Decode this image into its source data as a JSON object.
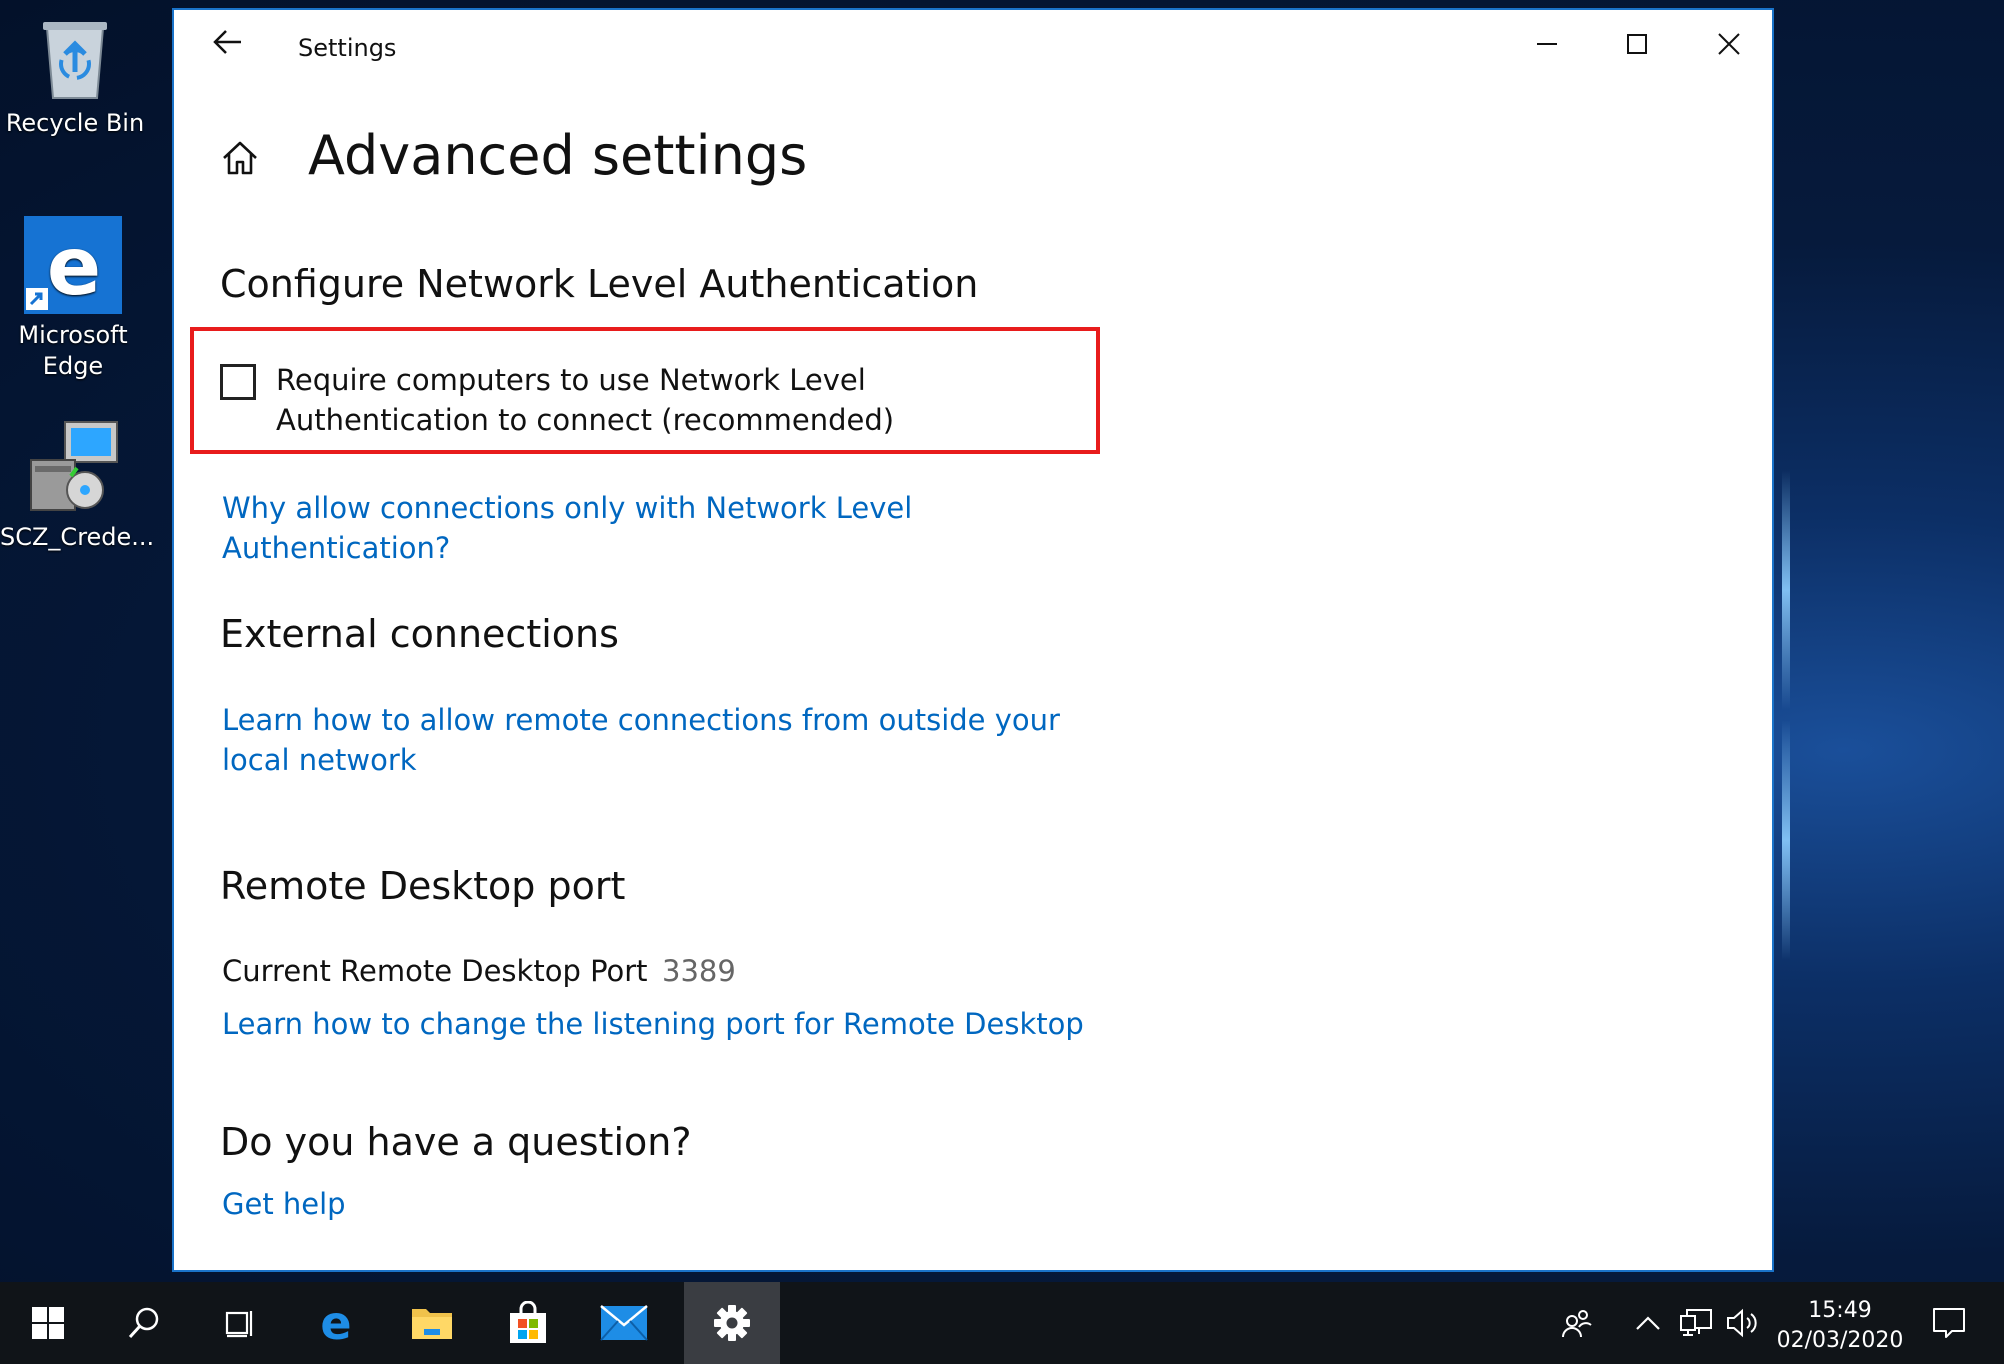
{
  "desktop": {
    "icons": [
      {
        "label": "Recycle Bin"
      },
      {
        "label": "Microsoft Edge"
      },
      {
        "label": "SCZ_Crede..."
      }
    ]
  },
  "window": {
    "title": "Settings",
    "page_title": "Advanced settings",
    "nla": {
      "heading": "Configure Network Level Authentication",
      "checkbox_label": "Require computers to use Network Level Authentication to connect (recommended)",
      "checkbox_checked": false,
      "link": "Why allow connections only with Network Level Authentication?"
    },
    "external": {
      "heading": "External connections",
      "link": "Learn how to allow remote connections from outside your local network"
    },
    "port": {
      "heading": "Remote Desktop port",
      "label": "Current Remote Desktop Port",
      "value": "3389",
      "link": "Learn how to change the listening port for Remote Desktop"
    },
    "question": {
      "heading": "Do you have a question?",
      "link": "Get help"
    }
  },
  "taskbar": {
    "time": "15:49",
    "date": "02/03/2020",
    "apps": [
      "start-icon",
      "search-icon",
      "task-view-icon",
      "edge-icon",
      "file-explorer-icon",
      "store-icon",
      "mail-icon",
      "settings-icon"
    ],
    "active_app": "settings-icon"
  },
  "colors": {
    "link": "#0067c0",
    "highlight": "#e81c1c",
    "window_border": "#1a73c9",
    "taskbar": "#101418"
  }
}
